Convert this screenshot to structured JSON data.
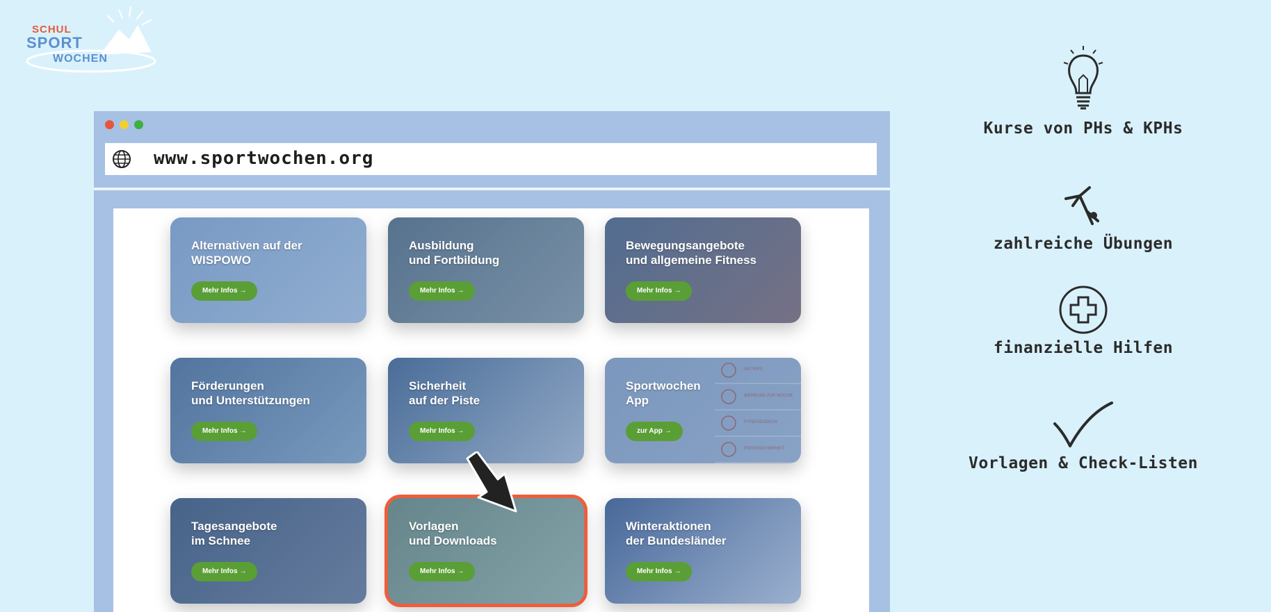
{
  "logo": {
    "line1": "SCHUL",
    "line2": "SPORT",
    "line3": "WOCHEN"
  },
  "browser": {
    "dots": [
      "#e8563a",
      "#f2cf2d",
      "#3fb040"
    ],
    "url": "www.sportwochen.org",
    "globe_icon": "globe-icon"
  },
  "cards": [
    {
      "title": "Alternativen auf der\nWISPOWO",
      "button": "Mehr Infos →",
      "bg": "#8fb0d6",
      "bg2": "#b7d2ea"
    },
    {
      "title": "Ausbildung\nund Fortbildung",
      "button": "Mehr Infos →",
      "bg": "#586f7b",
      "bg2": "#8fa2a6"
    },
    {
      "title": "Bewegungsangebote\nund allgemeine Fitness",
      "button": "Mehr Infos →",
      "bg": "#4f6680",
      "bg2": "#8a6d6c"
    },
    {
      "title": "Förderungen\nund Unterstützungen",
      "button": "Mehr Infos →",
      "bg": "#4f7296",
      "bg2": "#8fb1cc"
    },
    {
      "title": "Sicherheit\nauf der Piste",
      "button": "Mehr Infos →",
      "bg": "#41668c",
      "bg2": "#b9c9da"
    },
    {
      "title": "Sportwochen\nApp",
      "button": "zur App →",
      "bg": "#93acc9",
      "bg2": "#a9bfd8",
      "app_items": [
        {
          "label": "SKITIPPS",
          "icon": "ski-icon"
        },
        {
          "label": "WERBUNG ZUR WOCHE",
          "icon": "video-play-icon"
        },
        {
          "label": "FITNESSVIDEOS",
          "icon": "fitness-icon"
        },
        {
          "label": "PISTENSICHERHEIT",
          "icon": "helmet-icon"
        }
      ]
    },
    {
      "title": "Tagesangebote\nim Schnee",
      "button": "Mehr Infos →",
      "bg": "#3d5674",
      "bg2": "#6e7f95"
    },
    {
      "title": "Vorlagen\nund Downloads",
      "button": "Mehr Infos →",
      "bg": "#6f8f77",
      "bg2": "#9fbfa8"
    },
    {
      "title": "Winteraktionen\nder Bundesländer",
      "button": "Mehr Infos →",
      "bg": "#3e5e8e",
      "bg2": "#c9d6e8"
    }
  ],
  "features": [
    {
      "label": "Kurse von PHs & KPHs",
      "icon": "lightbulb-icon"
    },
    {
      "label": "zahlreiche Übungen",
      "icon": "gymnast-icon"
    },
    {
      "label": "finanzielle Hilfen",
      "icon": "plus-circle-icon"
    },
    {
      "label": "Vorlagen & Check-Listen",
      "icon": "checkmark-icon"
    }
  ],
  "colors": {
    "background": "#d9f1fb",
    "browser_frame": "#a6c1e3",
    "button_green": "#5a9e36",
    "highlight": "#ea5f3e"
  }
}
